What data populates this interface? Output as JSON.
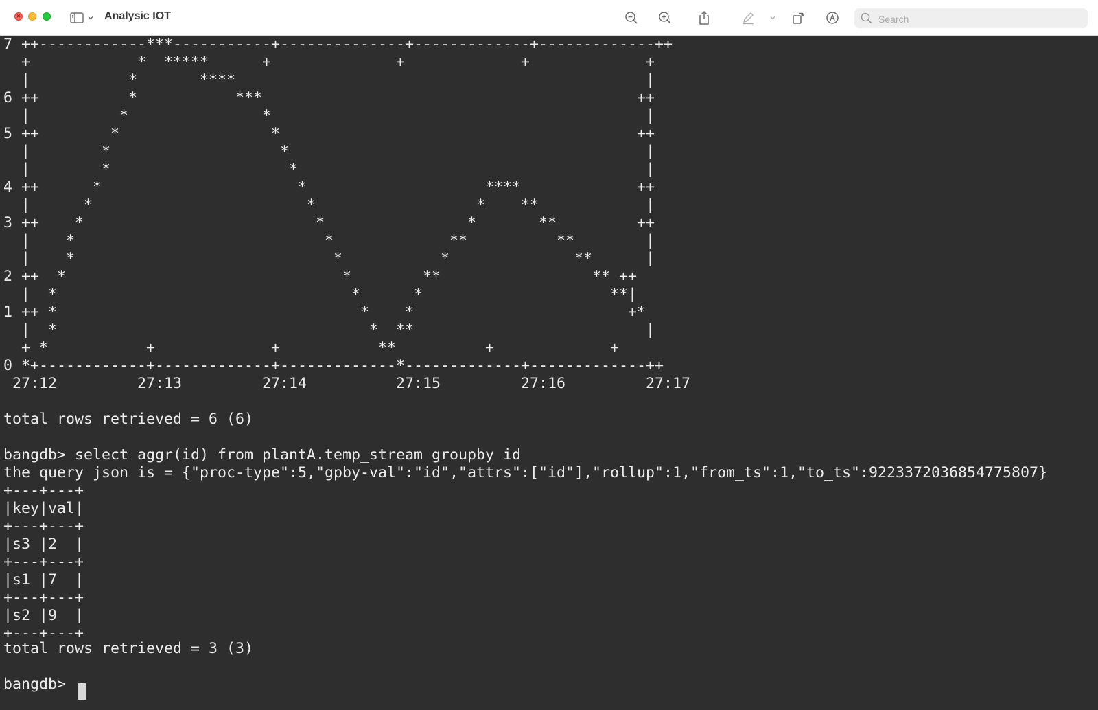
{
  "window": {
    "title": "Analysic IOT"
  },
  "toolbar": {
    "search_placeholder": "Search",
    "icons": [
      "sidebar-icon",
      "chevron-down-icon",
      "zoom-out-icon",
      "zoom-in-icon",
      "share-icon",
      "markup-pen-icon",
      "rotate-icon",
      "annotate-icon",
      "search-icon"
    ]
  },
  "terminal": {
    "plot_lines": [
      "7 ++------------***-----------+--------------+-------------+-------------++",
      "  +            *  *****      +              +             +             +",
      "  |           *       ****                                              |",
      "6 ++          *           ***                                          ++",
      "  |          *               *                                          |",
      "5 ++        *                 *                                        ++",
      "  |        *                   *                                        |",
      "  |        *                    *                                       |",
      "4 ++      *                      *                    ****             ++",
      "  |      *                        *                  *    **            |",
      "3 ++    *                          *                *       **         ++",
      "  |    *                            *             **          **        |",
      "  |    *                             *           *              **      |",
      "2 ++  *                               *        **                 ** ++",
      "  |  *                                 *      *                     **|",
      "1 ++ *                                  *    *                        +*",
      "  |  *                                   *  **                          |",
      "  + *           +             +           **          +             +",
      "0 *+------------+-------------+-------------*-------------+-------------++",
      " 27:12         27:13         27:14          27:15         27:16         27:17"
    ],
    "result_1": "total rows retrieved = 6 (6)",
    "command": "bangdb> select aggr(id) from plantA.temp_stream groupby id",
    "query_json": "the query json is = {\"proc-type\":5,\"gpby-val\":\"id\",\"attrs\":[\"id\"],\"rollup\":1,\"from_ts\":1,\"to_ts\":9223372036854775807}",
    "table_lines": [
      "+---+---+",
      "|key|val|",
      "+---+---+",
      "|s3 |2  |",
      "+---+---+",
      "|s1 |7  |",
      "+---+---+",
      "|s2 |9  |",
      "+---+---+"
    ],
    "result_2": "total rows retrieved = 3 (3)",
    "prompt": "bangdb> "
  },
  "colors": {
    "terminal_bg": "#2e2e2e",
    "terminal_fg": "#ebebeb",
    "titlebar_bg": "#ffffff"
  }
}
